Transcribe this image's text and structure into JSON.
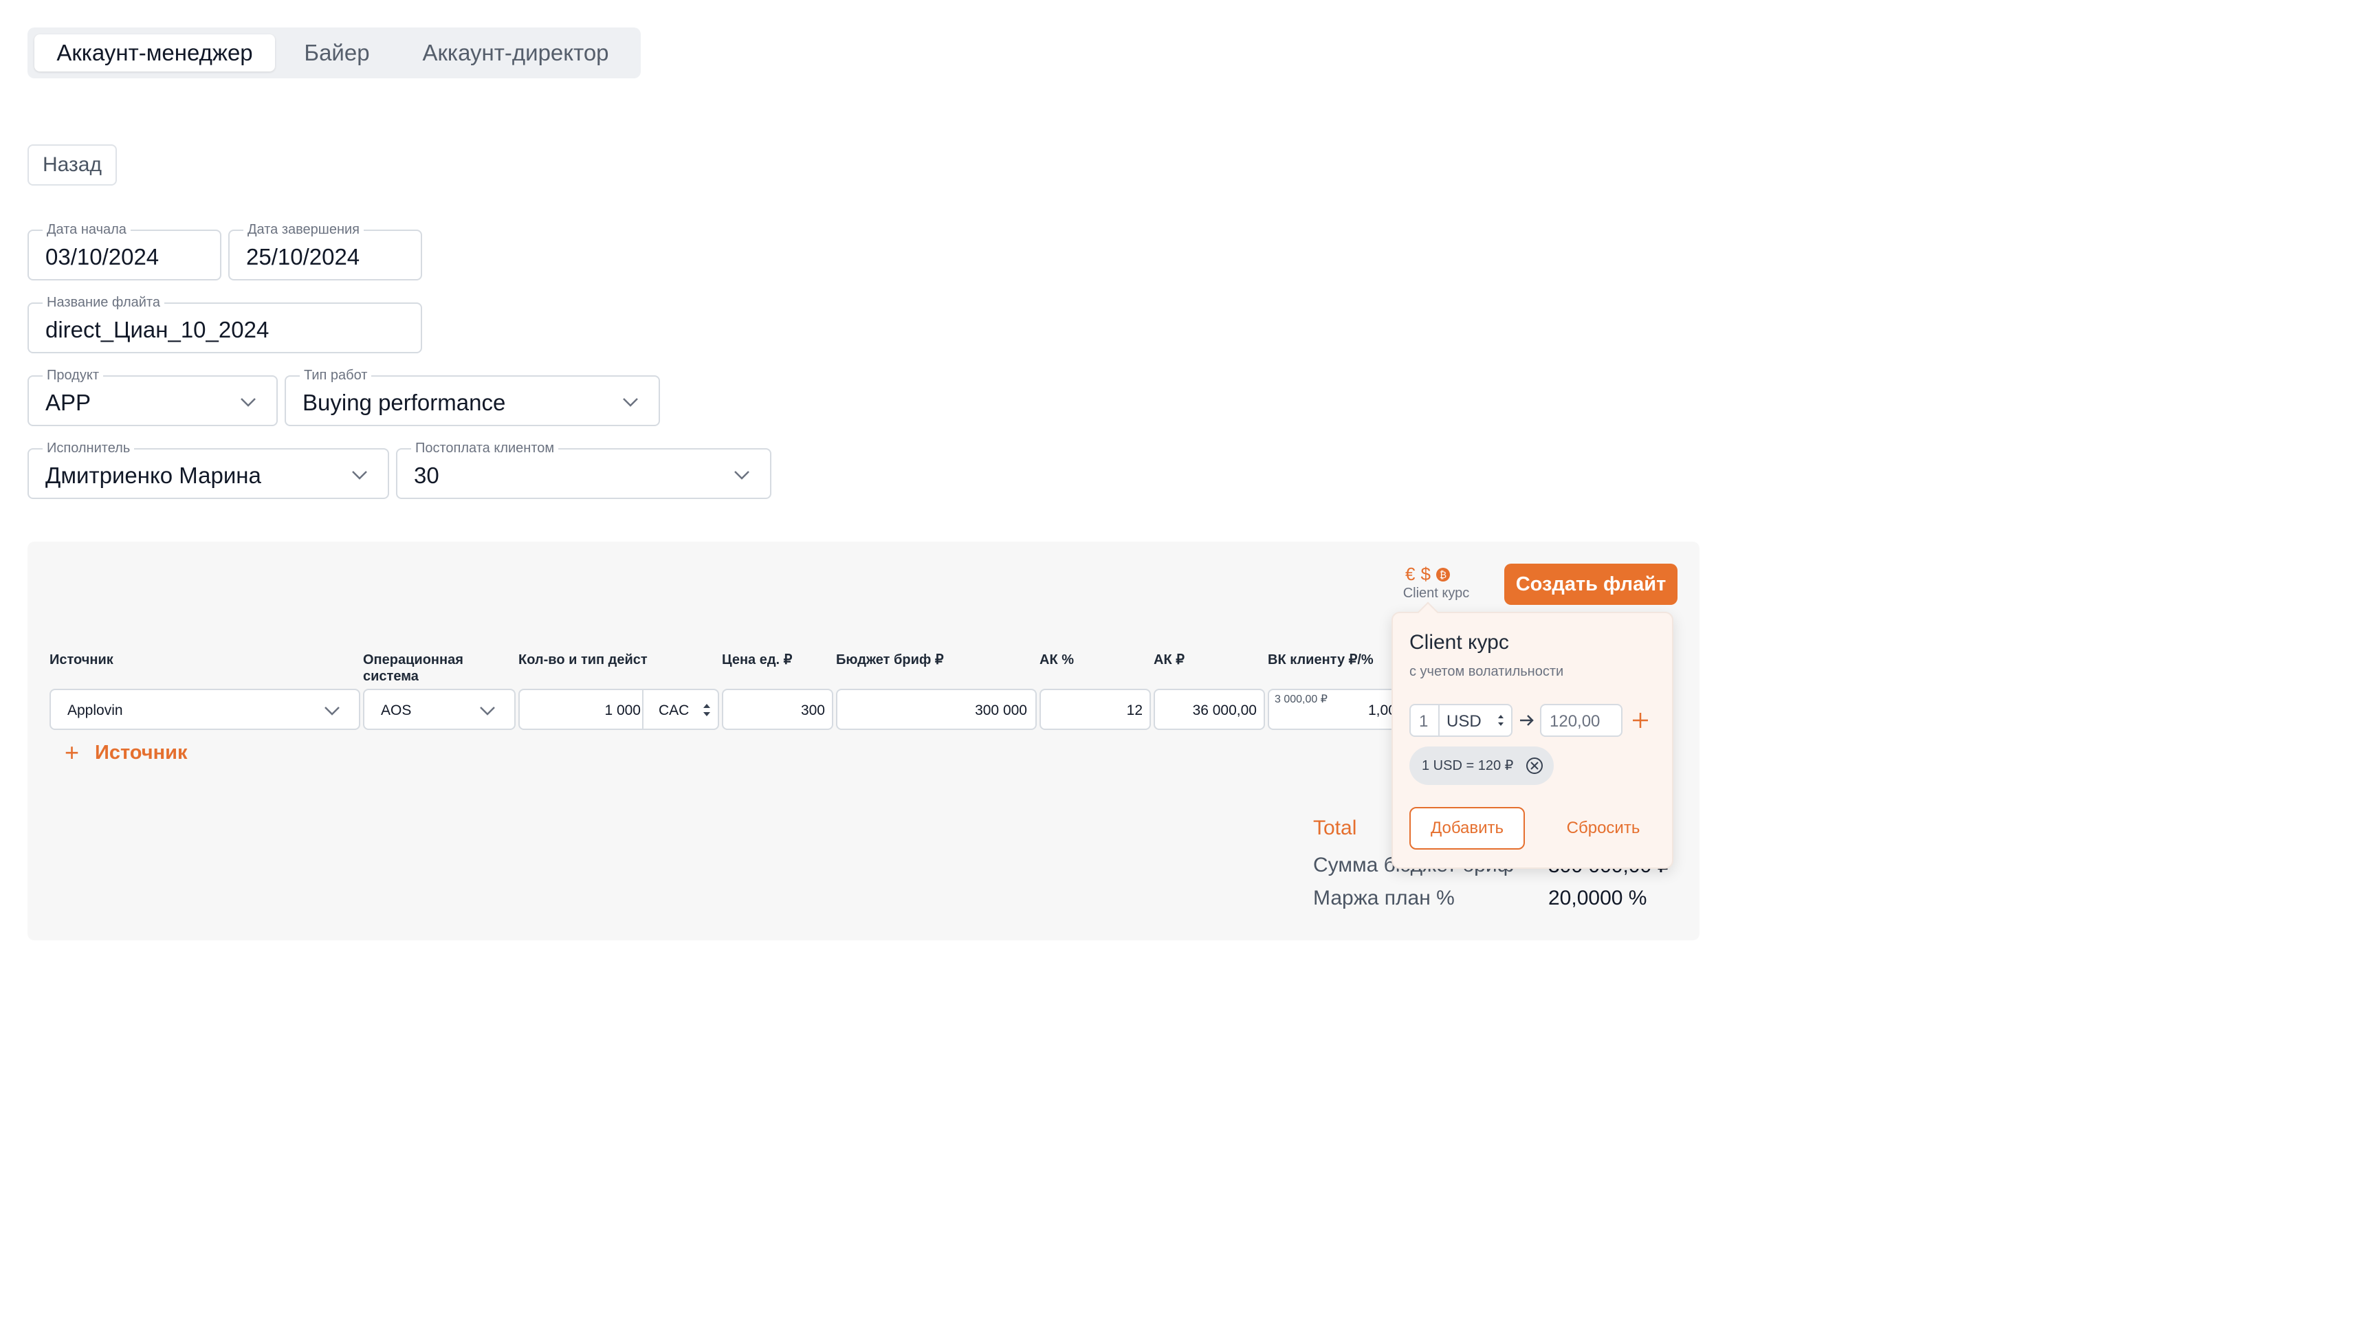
{
  "roles": {
    "tabs": [
      {
        "label": "Аккаунт-менеджер",
        "active": true
      },
      {
        "label": "Байер",
        "active": false
      },
      {
        "label": "Аккаунт-директор",
        "active": false
      }
    ]
  },
  "back_label": "Назад",
  "form": {
    "start_date": {
      "label": "Дата начала",
      "value": "03/10/2024"
    },
    "end_date": {
      "label": "Дата завершения",
      "value": "25/10/2024"
    },
    "flight_name": {
      "label": "Название флайта",
      "value": "direct_Циан_10_2024"
    },
    "product": {
      "label": "Продукт",
      "value": "APP"
    },
    "work_type": {
      "label": "Тип работ",
      "value": "Buying performance"
    },
    "executor": {
      "label": "Исполнитель",
      "value": "Дмитриенко Марина"
    },
    "postpay": {
      "label": "Постоплата клиентом",
      "value": "30"
    }
  },
  "toolbar": {
    "currency_icons": [
      "€",
      "$",
      "₿"
    ],
    "client_rate_label": "Client курс",
    "create_flight_label": "Создать флайт"
  },
  "table": {
    "headers": {
      "source": "Источник",
      "os": "Операционная система",
      "qty": "Кол-во и тип дейст",
      "unit_price": "Цена ед. ₽",
      "budget": "Бюджет бриф ₽",
      "ak_pct": "АК %",
      "ak_rub": "АК ₽",
      "vk_client": "ВК клиенту ₽/%"
    },
    "rows": [
      {
        "source": "Applovin",
        "os": "AOS",
        "qty": "1 000",
        "action_type": "CAC",
        "unit_price": "300",
        "budget": "300 000",
        "ak_pct": "12",
        "ak_rub": "36 000,00",
        "vk_hint": "3 000,00 ₽",
        "vk_value": "1,00"
      }
    ],
    "add_source_label": "Источник"
  },
  "totals": {
    "title": "Total",
    "budget_sum_label": "Сумма бюджет бриф",
    "budget_sum_value": "300 000,00 ₽",
    "margin_label": "Маржа план %",
    "margin_value": "20,0000 %"
  },
  "client_rate_popover": {
    "title": "Client курс",
    "subtitle": "с учетом волатильности",
    "amount": "1",
    "currency": "USD",
    "rate": "120,00",
    "chip_text": "1 USD = 120 ₽",
    "add_label": "Добавить",
    "reset_label": "Сбросить"
  },
  "colors": {
    "accent": "#e8722c",
    "panel_bg": "#f7f7f7",
    "border": "#d6dbe1"
  }
}
